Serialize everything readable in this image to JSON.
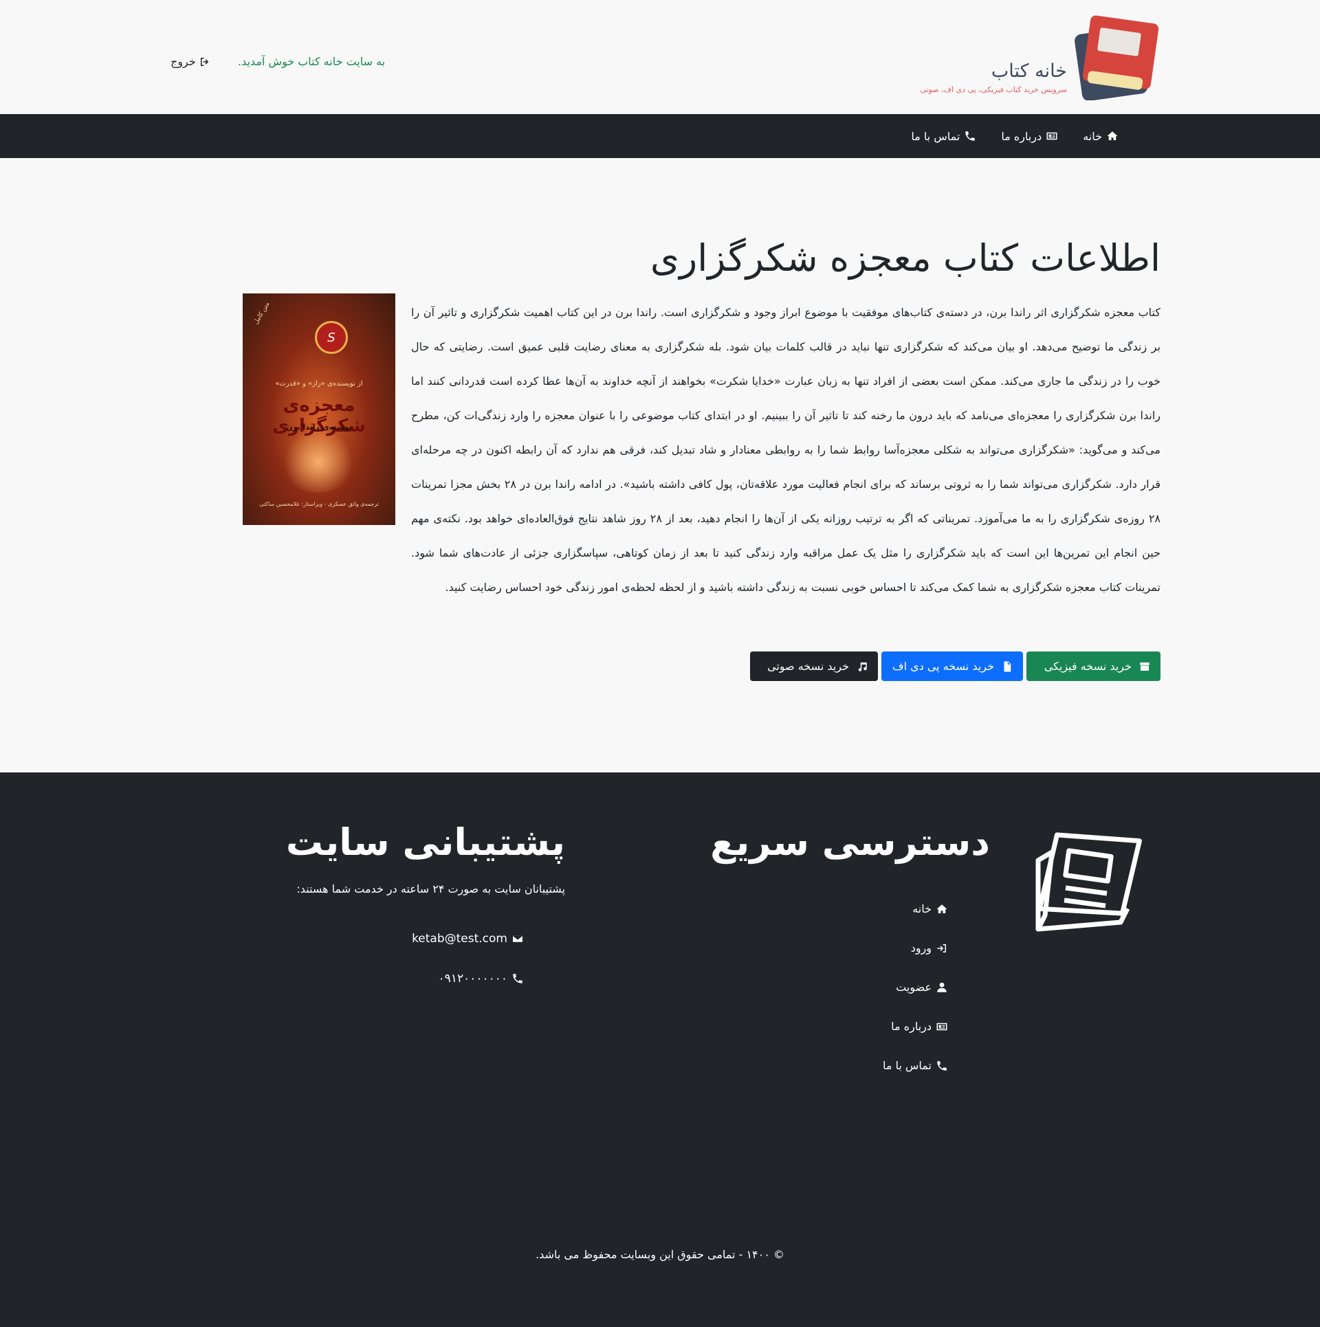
{
  "header": {
    "logo_title": "خانه کتاب",
    "logo_subtitle": "سرویس خرید کتاب فیزیکی، پی دی اف، صوتی",
    "welcome": "به سایت خانه کتاب خوش آمدید.",
    "logout": "خروج"
  },
  "nav": {
    "items": [
      {
        "label": "خانه",
        "icon": "home-icon"
      },
      {
        "label": "درباره ما",
        "icon": "id-card-icon"
      },
      {
        "label": "تماس با ما",
        "icon": "phone-icon"
      }
    ]
  },
  "book": {
    "title": "اطلاعات کتاب معجزه شکرگزاری",
    "description": "کتاب معجزه شکرگزاری اثر راندا برن، در دسته‌ی کتاب‌های موفقیت با موضوع ابراز وجود و شکرگزاری است. راندا برن در این کتاب اهمیت شکرگزاری و تاثیر آن را بر زندگی ما توضیح می‌دهد. او بیان می‌کند که شکرگزاری تنها نباید در قالب کلمات بیان شود. بله شکرگزاری به معنای رضایت قلبی عمیق است. رضایتی که حال خوب را در زندگی ما جاری می‌کند. ممکن است بعضی از افراد تنها به زبان عبارت «خدایا شکرت» بخواهند از آنچه خداوند به آن‌ها عطا کرده است قدردانی کنند اما راندا برن شکرگزاری را معجزه‌ای می‌نامد که باید درون ما رخنه کند تا تاثیر آن را ببینیم. او در ابتدای کتاب موضوعی را با عنوان معجزه را وارد زندگی‌ات کن، مطرح می‌کند و می‌گوید: «شکرگزاری می‌تواند به شکلی معجزه‌آسا روابط شما را به روابطی معنادار و شاد تبدیل کند، فرقی هم ندارد که آن رابطه اکنون در چه مرحله‌ای قرار دارد. شکرگزاری می‌تواند شما را به ثروتی برساند که برای انجام فعالیت مورد علاقه‌تان، پول کافی داشته باشید». در ادامه راندا برن در ۲۸ بخش مجزا تمرینات ۲۸ روزه‌ی شکرگزاری را به ما می‌آموزد. تمریناتی که اگر به ترتیب روزانه یکی از آن‌ها را انجام دهید، بعد از ۲۸ روز شاهد نتایج فوق‌العاده‌ای خواهد بود. نکته‌ی مهم حین انجام این تمرین‌ها این است که باید شکرگزاری را مثل یک عمل مراقبه وارد زندگی کنید تا بعد از زمان کوتاهی، سپاسگزاری جزئی از عادت‌های شما شود. تمرینات کتاب معجزه شکرگزاری به شما کمک می‌کند تا احساس خوبی نسبت به زندگی داشته باشید و از لحظه لحظه‌ی امور زندگی خود احساس رضایت کنید.",
    "cover": {
      "subtitle_top": "از نویسنده‌ی «راز» و «قدرت»",
      "title": "معجزه‌ی شکرگزاری",
      "author_line": "نوشته‌ی راندا برن",
      "translator_line": "ترجمه‌ی واثق عسکری - ویراستار: غلامحسین ساکتی",
      "seal_text": "S",
      "corner_text": "متن کامل"
    },
    "buttons": {
      "physical": "خرید نسخه فیزیکی",
      "pdf": "خرید نسخه پی دی اف",
      "audio": "خرید نسخه صوتی"
    }
  },
  "footer": {
    "quick_title": "دسترسی سریع",
    "quick_links": [
      {
        "label": "خانه",
        "icon": "home-icon"
      },
      {
        "label": "ورود",
        "icon": "sign-in-icon"
      },
      {
        "label": "عضویت",
        "icon": "user-icon"
      },
      {
        "label": "درباره ما",
        "icon": "id-card-icon"
      },
      {
        "label": "تماس با ما",
        "icon": "phone-icon"
      }
    ],
    "support_title": "پشتیبانی سایت",
    "support_text": "پشتیبانان سایت به صورت ۲۴ ساعته در خدمت شما هستند:",
    "email": "ketab@test.com",
    "phone": "۰۹۱۲۰۰۰۰۰۰۰",
    "copyright": "© ۱۴۰۰ - تمامی حقوق این وبسایت محفوظ می باشد."
  },
  "colors": {
    "green": "#198754",
    "blue": "#0d6efd",
    "dark": "#212529"
  }
}
